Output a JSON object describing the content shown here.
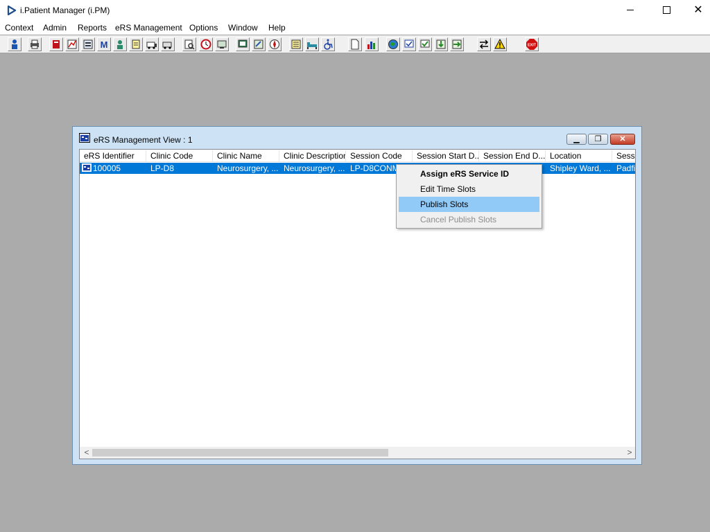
{
  "app": {
    "title": "i.Patient Manager (i.PM)"
  },
  "menubar": {
    "items": [
      "Context",
      "Admin",
      "Reports",
      "eRS Management",
      "Options",
      "Window",
      "Help"
    ]
  },
  "toolbar": {
    "icons": [
      "patient-icon",
      "printer-icon",
      "book-icon",
      "chart-icon",
      "form-icon",
      "letter-m-icon",
      "doctor-icon",
      "notes-icon",
      "ambulance-icon",
      "vehicle-icon",
      "search-doc-icon",
      "clock-icon",
      "monitor-icon",
      "screen-icon",
      "edit-icon",
      "compass-icon",
      "list-icon",
      "bed-icon",
      "wheelchair-icon",
      "document-icon",
      "bar-chart-icon",
      "globe-icon",
      "check-list-icon",
      "approve-icon",
      "import-icon",
      "export-icon",
      "transfer-icon",
      "warning-icon",
      "exit-icon"
    ],
    "exit_label": "EXIT"
  },
  "child_window": {
    "title": "eRS Management View : 1",
    "columns": [
      "eRS Identifier",
      "Clinic Code",
      "Clinic Name",
      "Clinic Description",
      "Session Code",
      "Session Start D...",
      "Session End D...",
      "Location",
      "Sessi"
    ],
    "rows": [
      {
        "ers_identifier": "100005",
        "clinic_code": "LP-D8",
        "clinic_name": "Neurosurgery, ...",
        "clinic_description": "Neurosurgery, ...",
        "session_code": "LP-D8CONM5",
        "location": "Shipley Ward, ...",
        "session": "Padfi"
      }
    ]
  },
  "context_menu": {
    "items": [
      {
        "label": "Assign eRS Service ID",
        "state": "default"
      },
      {
        "label": "Edit Time Slots",
        "state": "normal"
      },
      {
        "label": "Publish Slots",
        "state": "highlighted"
      },
      {
        "label": "Cancel Publish Slots",
        "state": "disabled"
      }
    ]
  },
  "colors": {
    "desktop": "#ababab",
    "selection": "#0078d7",
    "menu_highlight": "#91c9f7",
    "window_frame": "#cde3f5"
  }
}
